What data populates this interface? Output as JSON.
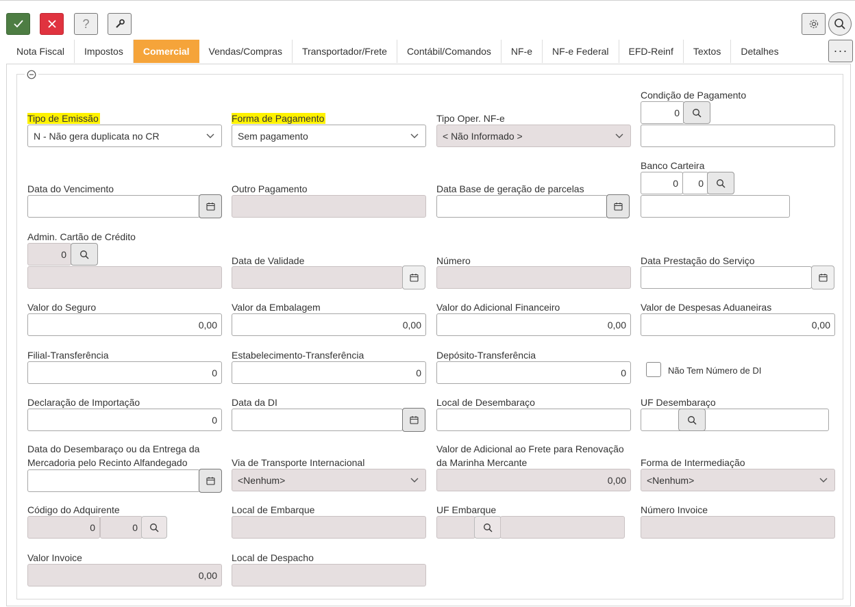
{
  "toolbar": {
    "help_label": "?",
    "more_label": "···"
  },
  "tabs": [
    "Nota Fiscal",
    "Impostos",
    "Comercial",
    "Vendas/Compras",
    "Transportador/Frete",
    "Contábil/Comandos",
    "NF-e",
    "NF-e Federal",
    "EFD-Reinf",
    "Textos",
    "Detalhes"
  ],
  "active_tab": "Comercial",
  "highlight_color": "#fff200",
  "fields": {
    "tipo_emissao": {
      "label": "Tipo de Emissão",
      "value": "N - Não gera duplicata no CR"
    },
    "forma_pagamento": {
      "label": "Forma de Pagamento",
      "value": "Sem pagamento"
    },
    "tipo_oper_nfe": {
      "label": "Tipo Oper. NF-e",
      "value": "< Não Informado >"
    },
    "condicao_pagamento": {
      "label": "Condição de Pagamento",
      "code": "0",
      "desc": ""
    },
    "data_vencimento": {
      "label": "Data do Vencimento",
      "value": ""
    },
    "outro_pagamento": {
      "label": "Outro Pagamento",
      "value": ""
    },
    "data_base_parcelas": {
      "label": "Data Base de geração de parcelas",
      "value": ""
    },
    "banco_carteira": {
      "label": "Banco Carteira",
      "banco": "0",
      "carteira": "0",
      "desc": ""
    },
    "admin_cartao": {
      "label": "Admin. Cartão de Crédito",
      "code": "0",
      "desc": ""
    },
    "data_validade": {
      "label": "Data de Validade",
      "value": ""
    },
    "numero": {
      "label": "Número",
      "value": ""
    },
    "data_prestacao": {
      "label": "Data Prestação do Serviço",
      "value": ""
    },
    "valor_seguro": {
      "label": "Valor do Seguro",
      "value": "0,00"
    },
    "valor_embalagem": {
      "label": "Valor da Embalagem",
      "value": "0,00"
    },
    "valor_adicional_financeiro": {
      "label": "Valor do Adicional Financeiro",
      "value": "0,00"
    },
    "valor_despesas_aduaneiras": {
      "label": "Valor de Despesas Aduaneiras",
      "value": "0,00"
    },
    "filial_transferencia": {
      "label": "Filial-Transferência",
      "value": "0"
    },
    "estabelecimento_transferencia": {
      "label": "Estabelecimento-Transferência",
      "value": "0"
    },
    "deposito_transferencia": {
      "label": "Depósito-Transferência",
      "value": "0"
    },
    "nao_tem_numero_di": {
      "label": "Não Tem Número de DI",
      "checked": false
    },
    "declaracao_importacao": {
      "label": "Declaração de Importação",
      "value": "0"
    },
    "data_di": {
      "label": "Data da DI",
      "value": ""
    },
    "local_desembaraco": {
      "label": "Local de Desembaraço",
      "value": ""
    },
    "uf_desembaraco": {
      "label": "UF Desembaraço",
      "code": "",
      "desc": ""
    },
    "data_desembaraco": {
      "label1": "Data do Desembaraço ou da Entrega da",
      "label2": "Mercadoria pelo Recinto Alfandegado",
      "value": ""
    },
    "via_transporte": {
      "label": "Via de Transporte Internacional",
      "value": "<Nenhum>"
    },
    "valor_adicional_frete": {
      "label1": "Valor de Adicional ao Frete para Renovação",
      "label2": "da Marinha Mercante",
      "value": "0,00"
    },
    "forma_intermediacao": {
      "label": "Forma de Intermediação",
      "value": "<Nenhum>"
    },
    "codigo_adquirente": {
      "label": "Código do Adquirente",
      "code1": "0",
      "code2": "0"
    },
    "local_embarque": {
      "label": "Local de Embarque",
      "value": ""
    },
    "uf_embarque": {
      "label": "UF Embarque",
      "code": "",
      "desc": ""
    },
    "numero_invoice": {
      "label": "Número Invoice",
      "value": ""
    },
    "valor_invoice": {
      "label": "Valor Invoice",
      "value": "0,00"
    },
    "local_despacho": {
      "label": "Local de Despacho",
      "value": ""
    }
  }
}
